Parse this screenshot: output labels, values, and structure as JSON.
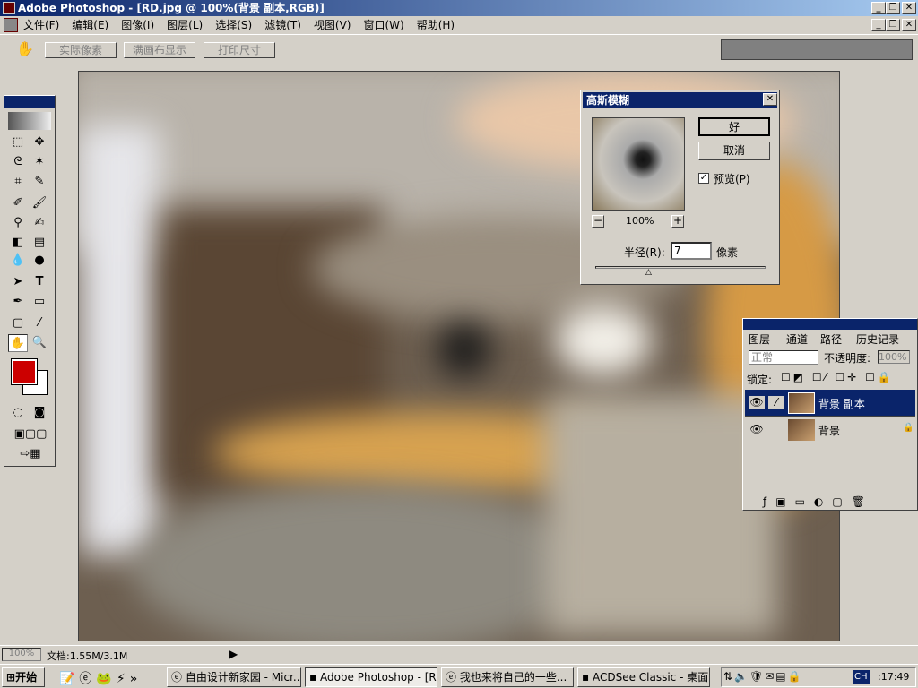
{
  "window": {
    "title": "Adobe Photoshop - [RD.jpg @ 100%(背景 副本,RGB)]"
  },
  "menu": [
    "文件(F)",
    "编辑(E)",
    "图像(I)",
    "图层(L)",
    "选择(S)",
    "滤镜(T)",
    "视图(V)",
    "窗口(W)",
    "帮助(H)"
  ],
  "options": {
    "actual_pixels": "实际像素",
    "fit_screen": "满画布显示",
    "print_size": "打印尺寸"
  },
  "colors": {
    "foreground": "#cc0000",
    "background": "#ffffff",
    "accent": "#0a246a"
  },
  "dialog": {
    "title": "高斯模糊",
    "ok": "好",
    "cancel": "取消",
    "preview_label": "预览(P)",
    "preview_checked": true,
    "zoom": "100%",
    "zoom_out": "−",
    "zoom_in": "+",
    "radius_label": "半径(R):",
    "radius_value": "7",
    "unit": "像素"
  },
  "layers_panel": {
    "tabs": [
      "图层",
      "通道",
      "路径",
      "历史记录"
    ],
    "blend_mode": "正常",
    "opacity_label": "不透明度:",
    "opacity_value": "100%",
    "lock_label": "锁定:",
    "layers": [
      {
        "name": "背景 副本",
        "selected": true
      },
      {
        "name": "背景",
        "selected": false,
        "locked": true
      }
    ]
  },
  "status": {
    "zoom": "100%",
    "doc": "文档:1.55M/3.1M"
  },
  "taskbar": {
    "start": "开始",
    "tasks": [
      "自由设计新家园 - Micr...",
      "Adobe Photoshop - [RD...",
      "我也来将自己的一些...",
      "ACDSee Classic - 桌面"
    ],
    "lang": "CH",
    "clock": ":17:49"
  }
}
